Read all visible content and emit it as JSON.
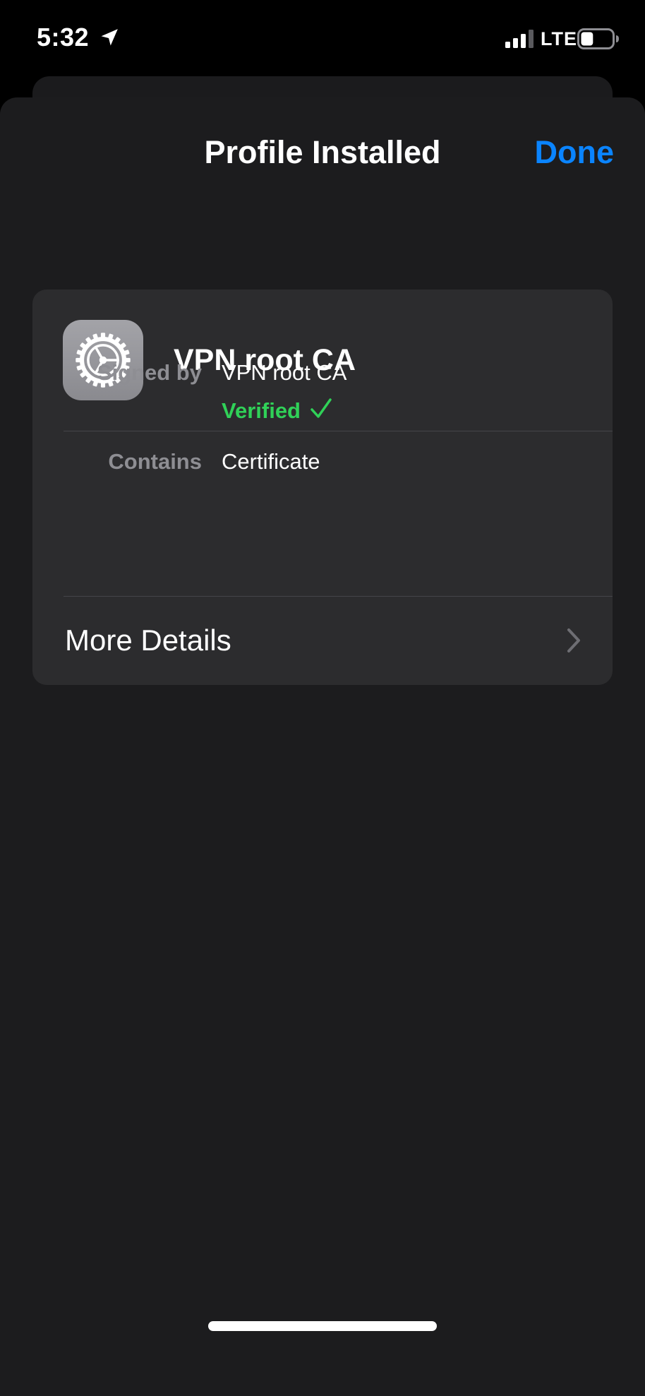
{
  "status_bar": {
    "time": "5:32",
    "network": "LTE",
    "location_icon": "location-arrow-icon",
    "signal_icon": "cellular-signal-icon",
    "battery_icon": "battery-icon",
    "battery_level": 0.4
  },
  "nav": {
    "title": "Profile Installed",
    "done_label": "Done"
  },
  "profile": {
    "icon": "settings-gear-icon",
    "name": "VPN root CA",
    "signed_by_label": "Signed by",
    "signed_by_value": "VPN root CA",
    "verified_label": "Verified",
    "verified_icon": "checkmark-icon",
    "contains_label": "Contains",
    "contains_value": "Certificate",
    "more_details_label": "More Details",
    "more_details_icon": "chevron-right-icon"
  },
  "colors": {
    "accent": "#0a84ff",
    "verified": "#30d158",
    "card_background": "#2c2c2e",
    "sheet_background": "#1c1c1e",
    "secondary_text": "#8e8e93"
  }
}
